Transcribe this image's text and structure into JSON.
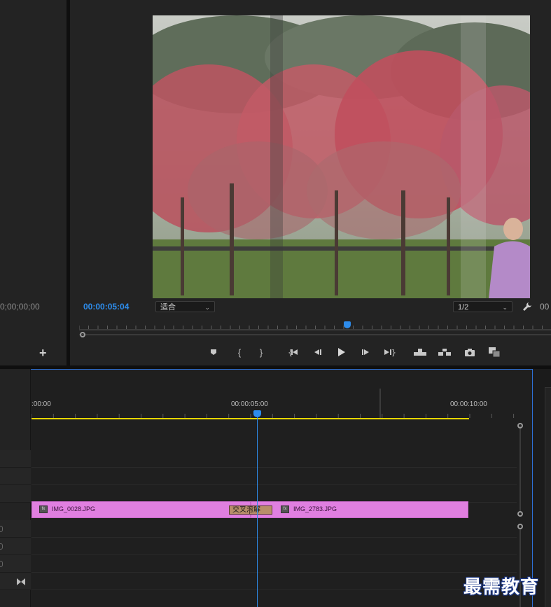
{
  "source_panel": {
    "timecode": "0;00;00;00",
    "add_button": "+"
  },
  "program_monitor": {
    "timecode": "00:00:05:04",
    "zoom_label": "适合",
    "resolution_label": "1/2",
    "end_timecode_fragment": "00",
    "controls": [
      "add-marker",
      "mark-in",
      "mark-out",
      "go-to-in",
      "step-back",
      "play",
      "step-forward",
      "go-to-out",
      "lift",
      "extract",
      "export-frame",
      "button-editor"
    ]
  },
  "timeline": {
    "ruler_labels": [
      ":00:00",
      "00:00:05:00",
      "00:00:10:00"
    ],
    "clips": [
      {
        "name": "IMG_0028.JPG",
        "fx": "fx"
      },
      {
        "name": "IMG_2783.JPG",
        "fx": "fx"
      }
    ],
    "transition_label": "交叉溶解"
  },
  "watermark": "最需教育",
  "colors": {
    "timecode_blue": "#2d8ceb",
    "clip_pink": "#e07fe0",
    "work_area_yellow": "#e6d600",
    "playhead_blue": "#2d8ceb"
  }
}
